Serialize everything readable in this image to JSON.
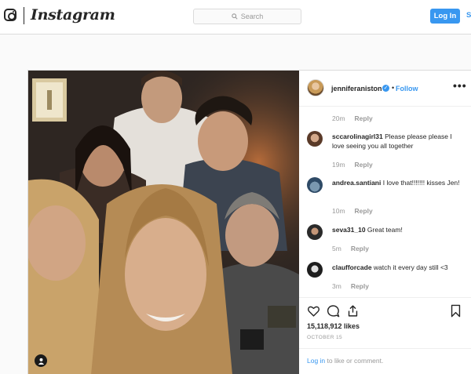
{
  "header": {
    "wordmark": "Instagram",
    "search_placeholder": "Search",
    "login_label": "Log In",
    "signup_label": "S"
  },
  "post": {
    "username": "jenniferaniston",
    "verified": true,
    "follow_dot": "•",
    "follow_label": "Follow",
    "more_label": "•••",
    "comments": [
      {
        "time": "20m",
        "reply": "Reply"
      },
      {
        "user": "sccarolinagirl31",
        "text": "Please please please I love seeing you all together",
        "time": "19m",
        "reply": "Reply"
      },
      {
        "user": "andrea.santiani",
        "text": "I love that!!!!!!! kisses Jen!",
        "time": "10m",
        "reply": "Reply"
      },
      {
        "user": "seva31_10",
        "text": "Great team!",
        "time": "5m",
        "reply": "Reply"
      },
      {
        "user": "claufforcade",
        "text": "watch it every day still <3",
        "time": "3m",
        "reply": "Reply"
      }
    ],
    "likes": "15,118,912 likes",
    "date": "OCTOBER 15",
    "login_link": "Log in",
    "login_text": " to like or comment."
  },
  "colors": {
    "accent": "#3897f0",
    "border": "#dbdbdb",
    "muted": "#999999",
    "text": "#262626"
  },
  "icons": [
    "instagram-glyph-icon",
    "search-icon",
    "verified-badge-icon",
    "more-options-icon",
    "heart-icon",
    "comment-icon",
    "share-icon",
    "bookmark-icon",
    "user-tag-icon"
  ]
}
